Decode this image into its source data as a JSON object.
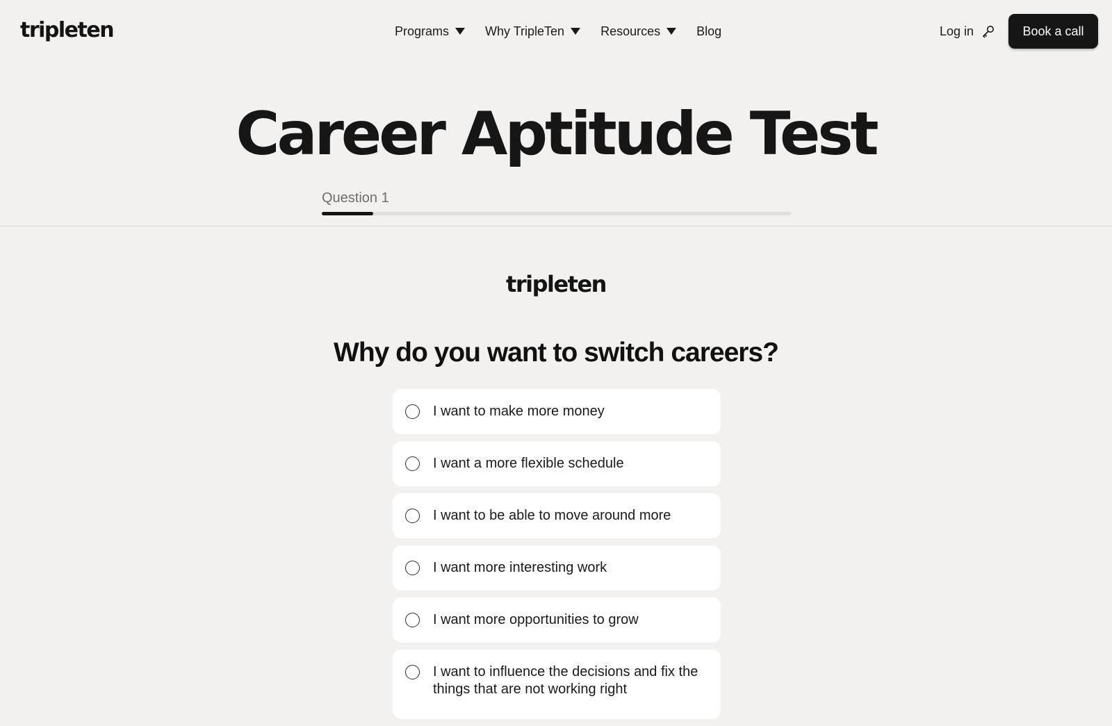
{
  "header": {
    "logo_text": "tripleten",
    "nav": [
      {
        "label": "Programs",
        "has_dropdown": true
      },
      {
        "label": "Why TripleTen",
        "has_dropdown": true
      },
      {
        "label": "Resources",
        "has_dropdown": true
      },
      {
        "label": "Blog",
        "has_dropdown": false
      }
    ],
    "login_label": "Log in",
    "login_icon": "key-icon",
    "cta_label": "Book a call"
  },
  "hero": {
    "title": "Career Aptitude Test",
    "question_label": "Question 1",
    "progress_fraction": 0.11
  },
  "quiz": {
    "logo_text": "tripleten",
    "question": "Why do you want to switch careers?",
    "options": [
      {
        "label": "I want to make more money"
      },
      {
        "label": "I want a more flexible schedule"
      },
      {
        "label": "I want to be able to move around more"
      },
      {
        "label": "I want more interesting work"
      },
      {
        "label": "I want more opportunities to grow"
      },
      {
        "label": "I want to influence the decisions and fix the things that are not working right"
      }
    ]
  },
  "colors": {
    "background": "#f2f1ef",
    "text": "#141414",
    "button_bg": "#161616",
    "progress_track": "#dfdedc",
    "option_bg": "#ffffff",
    "muted_text": "#6d6d6d"
  }
}
